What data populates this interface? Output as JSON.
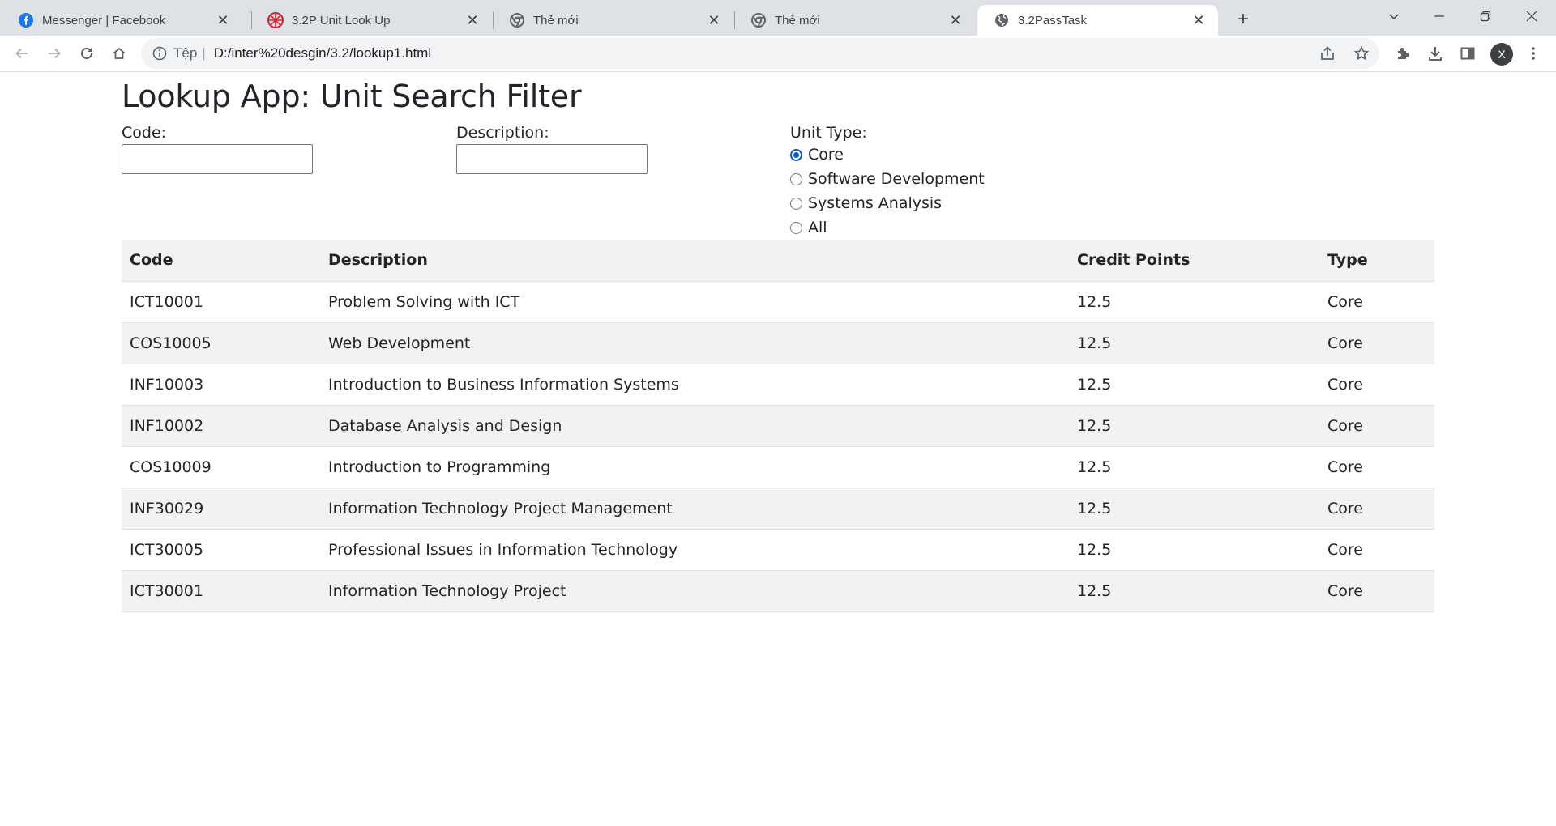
{
  "browser": {
    "tabs": [
      {
        "label": "Messenger | Facebook",
        "icon": "facebook-icon",
        "active": false
      },
      {
        "label": "3.2P Unit Look Up",
        "icon": "swinburne-icon",
        "active": false
      },
      {
        "label": "Thẻ mới",
        "icon": "chrome-icon",
        "active": false
      },
      {
        "label": "Thẻ mới",
        "icon": "chrome-icon",
        "active": false
      },
      {
        "label": "3.2PassTask",
        "icon": "globe-icon",
        "active": true
      }
    ],
    "address": {
      "scheme_label": "Tệp",
      "url": "D:/inter%20desgin/3.2/lookup1.html"
    },
    "profile_initial": "X",
    "accent": "#0b57d0"
  },
  "page": {
    "title": "Lookup App: Unit Search Filter",
    "filters": {
      "code_label": "Code:",
      "code_value": "",
      "description_label": "Description:",
      "description_value": "",
      "unit_type_label": "Unit Type:",
      "unit_type_options": [
        "Core",
        "Software Development",
        "Systems Analysis",
        "All"
      ],
      "unit_type_selected": "Core"
    },
    "table": {
      "headers": [
        "Code",
        "Description",
        "Credit Points",
        "Type"
      ],
      "rows": [
        [
          "ICT10001",
          "Problem Solving with ICT",
          "12.5",
          "Core"
        ],
        [
          "COS10005",
          "Web Development",
          "12.5",
          "Core"
        ],
        [
          "INF10003",
          "Introduction to Business Information Systems",
          "12.5",
          "Core"
        ],
        [
          "INF10002",
          "Database Analysis and Design",
          "12.5",
          "Core"
        ],
        [
          "COS10009",
          "Introduction to Programming",
          "12.5",
          "Core"
        ],
        [
          "INF30029",
          "Information Technology Project Management",
          "12.5",
          "Core"
        ],
        [
          "ICT30005",
          "Professional Issues in Information Technology",
          "12.5",
          "Core"
        ],
        [
          "ICT30001",
          "Information Technology Project",
          "12.5",
          "Core"
        ]
      ]
    }
  }
}
